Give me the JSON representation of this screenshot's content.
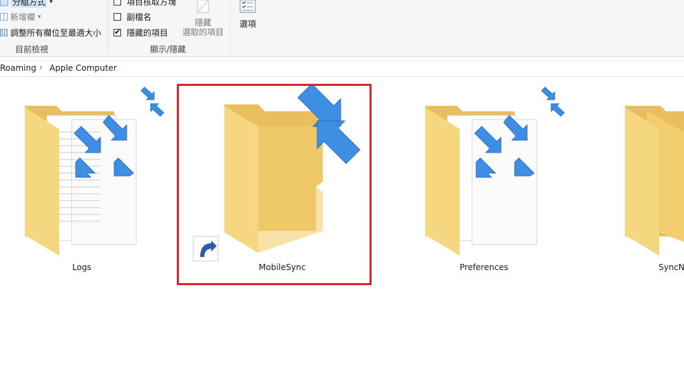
{
  "ribbon": {
    "layout_group": {
      "group_by_label": "分組方式",
      "add_column_label": "新增欄",
      "size_columns_label": "調整所有欄位至最適大小",
      "group_title": "目前檢視"
    },
    "show_hide_group": {
      "item_checkboxes_label": "項目核取方塊",
      "file_extensions_label": "副檔名",
      "hidden_items_label": "隱藏的項目",
      "hide_selected_label_line1": "隱藏",
      "hide_selected_label_line2": "選取的項目",
      "group_title": "顯示/隱藏"
    },
    "options_label": "選項"
  },
  "address": {
    "crumbs": [
      "Roaming",
      "Apple Computer"
    ]
  },
  "folders": [
    {
      "name": "Logs",
      "type": "folder-with-docs-sync"
    },
    {
      "name": "MobileSync",
      "type": "folder-shortcut-sync",
      "selected": true
    },
    {
      "name": "Preferences",
      "type": "folder-with-docs-sync"
    },
    {
      "name": "SyncN",
      "type": "folder"
    }
  ],
  "colors": {
    "folder_front": "#f5d77f",
    "folder_back": "#e9c063",
    "sync_arrow": "#3e8fe4",
    "selection_red": "#d9242b"
  }
}
